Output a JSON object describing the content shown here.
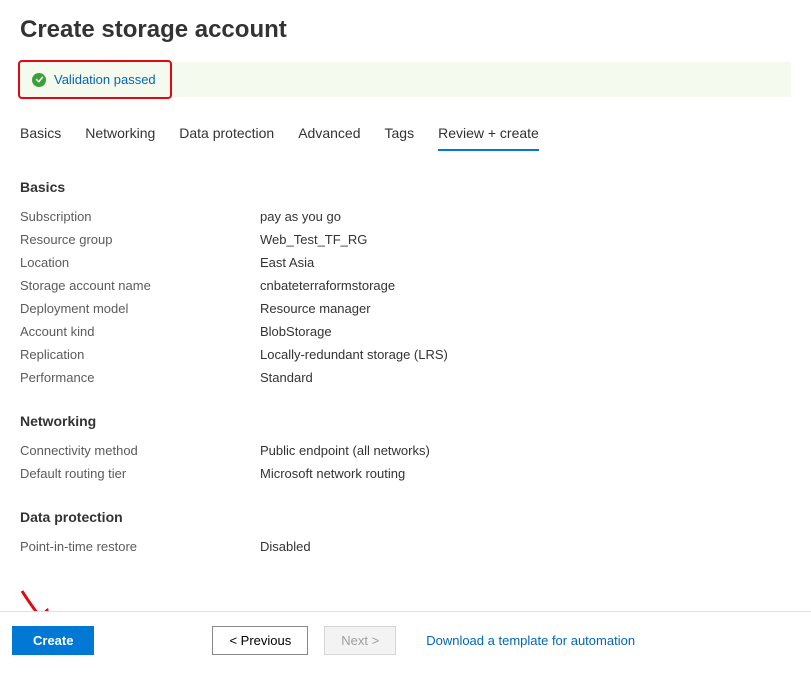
{
  "page": {
    "title": "Create storage account"
  },
  "validation": {
    "message": "Validation passed"
  },
  "tabs": [
    {
      "label": "Basics"
    },
    {
      "label": "Networking"
    },
    {
      "label": "Data protection"
    },
    {
      "label": "Advanced"
    },
    {
      "label": "Tags"
    },
    {
      "label": "Review + create"
    }
  ],
  "sections": {
    "basics": {
      "title": "Basics",
      "rows": [
        {
          "label": "Subscription",
          "value": "pay as you go"
        },
        {
          "label": "Resource group",
          "value": "Web_Test_TF_RG"
        },
        {
          "label": "Location",
          "value": "East Asia"
        },
        {
          "label": "Storage account name",
          "value": "cnbateterraformstorage"
        },
        {
          "label": "Deployment model",
          "value": "Resource manager"
        },
        {
          "label": "Account kind",
          "value": "BlobStorage"
        },
        {
          "label": "Replication",
          "value": "Locally-redundant storage (LRS)"
        },
        {
          "label": "Performance",
          "value": "Standard"
        }
      ]
    },
    "networking": {
      "title": "Networking",
      "rows": [
        {
          "label": "Connectivity method",
          "value": "Public endpoint (all networks)"
        },
        {
          "label": "Default routing tier",
          "value": "Microsoft network routing"
        }
      ]
    },
    "dataprotection": {
      "title": "Data protection",
      "rows": [
        {
          "label": "Point-in-time restore",
          "value": "Disabled"
        }
      ]
    }
  },
  "footer": {
    "create": "Create",
    "previous": "< Previous",
    "next": "Next >",
    "download": "Download a template for automation"
  }
}
